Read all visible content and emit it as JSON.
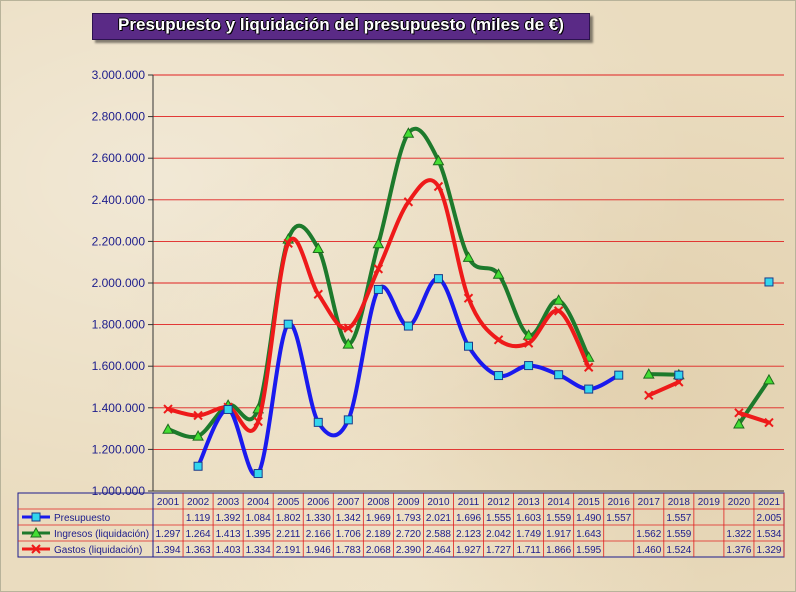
{
  "chart_data": {
    "type": "line",
    "title": "Presupuesto y liquidación del presupuesto (miles de €)",
    "xlabel": "",
    "ylabel": "",
    "ylim": [
      1000000,
      3000000
    ],
    "yticks": [
      "1.000.000",
      "1.200.000",
      "1.400.000",
      "1.600.000",
      "1.800.000",
      "2.000.000",
      "2.200.000",
      "2.400.000",
      "2.600.000",
      "2.800.000",
      "3.000.000"
    ],
    "grid": true,
    "legend": "data-table",
    "categories": [
      "2001",
      "2002",
      "2003",
      "2004",
      "2005",
      "2006",
      "2007",
      "2008",
      "2009",
      "2010",
      "2011",
      "2012",
      "2013",
      "2014",
      "2015",
      "2016",
      "2017",
      "2018",
      "2019",
      "2020",
      "2021"
    ],
    "series": [
      {
        "name": "Presupuesto",
        "color": "#1a1aee",
        "marker": "square",
        "values": [
          null,
          1119000,
          1392000,
          1084000,
          1802000,
          1330000,
          1342000,
          1969000,
          1793000,
          2021000,
          1696000,
          1555000,
          1603000,
          1559000,
          1490000,
          1557000,
          null,
          1557000,
          null,
          null,
          2005000
        ],
        "labels": [
          "",
          "1.119",
          "1.392",
          "1.084",
          "1.802",
          "1.330",
          "1.342",
          "1.969",
          "1.793",
          "2.021",
          "1.696",
          "1.555",
          "1.603",
          "1.559",
          "1.490",
          "1.557",
          "",
          "1.557",
          "",
          "",
          "2.005"
        ]
      },
      {
        "name": "Ingresos (liquidación)",
        "color": "#1d7a2c",
        "marker": "triangle",
        "values": [
          1297000,
          1264000,
          1413000,
          1395000,
          2211000,
          2166000,
          1706000,
          2189000,
          2720000,
          2588000,
          2123000,
          2042000,
          1749000,
          1917000,
          1643000,
          null,
          1562000,
          1559000,
          null,
          1322000,
          1534000
        ],
        "labels": [
          "1.297",
          "1.264",
          "1.413",
          "1.395",
          "2.211",
          "2.166",
          "1.706",
          "2.189",
          "2.720",
          "2.588",
          "2.123",
          "2.042",
          "1.749",
          "1.917",
          "1.643",
          "",
          "1.562",
          "1.559",
          "",
          "1.322",
          "1.534"
        ]
      },
      {
        "name": "Gastos (liquidación)",
        "color": "#ee1a1a",
        "marker": "x",
        "values": [
          1394000,
          1363000,
          1403000,
          1334000,
          2191000,
          1946000,
          1783000,
          2068000,
          2390000,
          2464000,
          1927000,
          1727000,
          1711000,
          1866000,
          1595000,
          null,
          1460000,
          1524000,
          null,
          1376000,
          1329000
        ],
        "labels": [
          "1.394",
          "1.363",
          "1.403",
          "1.334",
          "2.191",
          "1.946",
          "1.783",
          "2.068",
          "2.390",
          "2.464",
          "1.927",
          "1.727",
          "1.711",
          "1.866",
          "1.595",
          "",
          "1.460",
          "1.524",
          "",
          "1.376",
          "1.329"
        ]
      }
    ]
  }
}
